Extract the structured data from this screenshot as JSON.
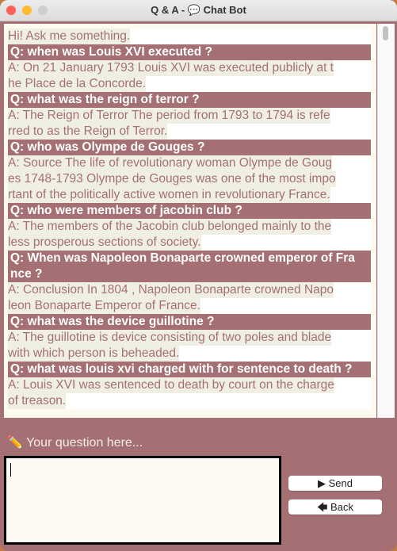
{
  "window": {
    "title": "Q & A - 💬 Chat Bot"
  },
  "chat": {
    "lines": [
      {
        "type": "a",
        "text": " Hi! Ask me something."
      },
      {
        "type": "q",
        "text": "Q: when was Louis XVI executed ?"
      },
      {
        "type": "a",
        "text": " A: On 21 January 1793 Louis XVI was executed publicly at t"
      },
      {
        "type": "a",
        "text": "he Place de la Concorde."
      },
      {
        "type": "q",
        "text": "Q: what was the reign of terror ?"
      },
      {
        "type": "a",
        "text": " A: The Reign of Terror The period from 1793 to 1794 is refe"
      },
      {
        "type": "a",
        "text": "rred to as the Reign of Terror."
      },
      {
        "type": "q",
        "text": "Q: who was Olympe de Gouges ?"
      },
      {
        "type": "a",
        "text": " A: Source The life of revolutionary woman Olympe de Goug"
      },
      {
        "type": "a",
        "text": "es 1748-1793 Olympe de Gouges was one of the most impo"
      },
      {
        "type": "a",
        "text": "rtant of the politically active women in revolutionary France."
      },
      {
        "type": "q",
        "text": "Q: who were members of jacobin club ?"
      },
      {
        "type": "a",
        "text": " A: The members of the Jacobin club belonged mainly to the"
      },
      {
        "type": "a",
        "text": "less prosperous sections of society."
      },
      {
        "type": "q",
        "text": "Q: When was Napoleon Bonaparte crowned emperor of Fra"
      },
      {
        "type": "q",
        "text": "nce ?"
      },
      {
        "type": "a",
        "text": " A: Conclusion In 1804 , Napoleon Bonaparte crowned Napo"
      },
      {
        "type": "a",
        "text": "leon Bonaparte Emperor of France."
      },
      {
        "type": "q",
        "text": "Q: what was the device guillotine ?"
      },
      {
        "type": "a",
        "text": " A: The guillotine is device consisting of two poles and blade"
      },
      {
        "type": "a",
        "text": "with which person is beheaded."
      },
      {
        "type": "q",
        "text": "Q: what was louis xvi charged with for sentence to death ?"
      },
      {
        "type": "a",
        "text": " A: Louis XVI was sentenced to death by court on the charge"
      },
      {
        "type": "a",
        "text": "of treason."
      }
    ]
  },
  "input": {
    "prompt": "✏️ Your question here...",
    "value": ""
  },
  "buttons": {
    "send": "▶ Send",
    "back": "🡄 Back"
  },
  "colors": {
    "accent": "#a57073",
    "answer_bg": "#f0efe4",
    "input_bg": "#fef9f2"
  }
}
